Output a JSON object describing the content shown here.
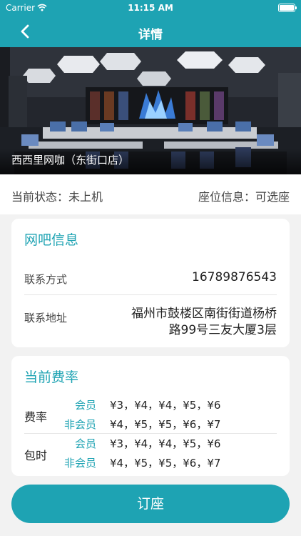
{
  "status_bar": {
    "carrier": "Carrier",
    "time": "11:15 AM"
  },
  "nav": {
    "title": "详情"
  },
  "hero": {
    "name": "西西里网咖（东街口店）"
  },
  "status": {
    "current_status": "当前状态：未上机",
    "seat_info": "座位信息：可选座"
  },
  "cafe_info": {
    "title": "网吧信息",
    "contact_label": "联系方式",
    "contact_value": "16789876543",
    "address_label": "联系地址",
    "address_line1": "福州市鼓楼区南街街道杨桥",
    "address_line2": "路99号三友大厦3层"
  },
  "rates": {
    "title": "当前费率",
    "groups": [
      {
        "label": "费率",
        "rows": [
          {
            "tier": "会员",
            "prices": "¥3，¥4，¥4，¥5，¥6"
          },
          {
            "tier": "非会员",
            "prices": "¥4，¥5，¥5，¥6，¥7"
          }
        ]
      },
      {
        "label": "包时",
        "rows": [
          {
            "tier": "会员",
            "prices": "¥3，¥4，¥4，¥5，¥6"
          },
          {
            "tier": "非会员",
            "prices": "¥4，¥5，¥5，¥6，¥7"
          }
        ]
      }
    ]
  },
  "actions": {
    "book_label": "订座"
  },
  "colors": {
    "accent": "#1ea3b3"
  }
}
